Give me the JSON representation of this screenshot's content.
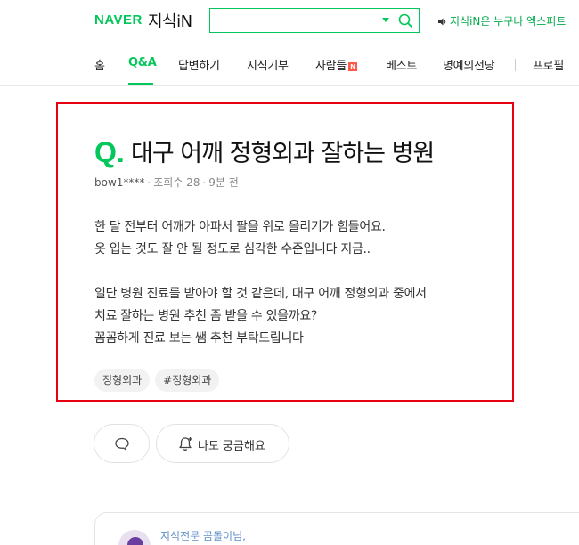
{
  "header": {
    "brand": "NAVER",
    "service": "지식iN",
    "search_value": "",
    "promo": "지식iN은 누구나 엑스퍼트"
  },
  "nav": {
    "items": [
      "홈",
      "Q&A",
      "답변하기",
      "지식기부",
      "사람들",
      "베스트",
      "명예의전당",
      "프로필"
    ],
    "active": "Q&A",
    "badge": "N"
  },
  "question": {
    "mark": "Q.",
    "title": "대구 어깨 정형외과 잘하는 병원",
    "author": "bow1****",
    "views": "조회수 28",
    "time": "9분 전",
    "body_lines": [
      "한 달 전부터 어깨가 아파서 팔을 위로 올리기가 힘들어요.",
      "옷 입는 것도 잘 안 될 정도로 심각한 수준입니다 지금..",
      "",
      "일단 병원 진료를 받아야 할 것 같은데, 대구 어깨 정형외과 중에서",
      "치료 잘하는 병원 추천 좀 받을 수 있을까요?",
      "꼼꼼하게 진료 보는 쌤 추천 부탁드립니다"
    ],
    "tags": [
      "정형외과",
      "#정형외과"
    ]
  },
  "actions": {
    "curious_label": "나도 궁금해요"
  },
  "answer": {
    "name": "지식전문 곰돌이님,"
  },
  "colors": {
    "brand_green": "#03c75a",
    "highlight_red": "#e60012",
    "answer_name": "#5f8fc8"
  }
}
